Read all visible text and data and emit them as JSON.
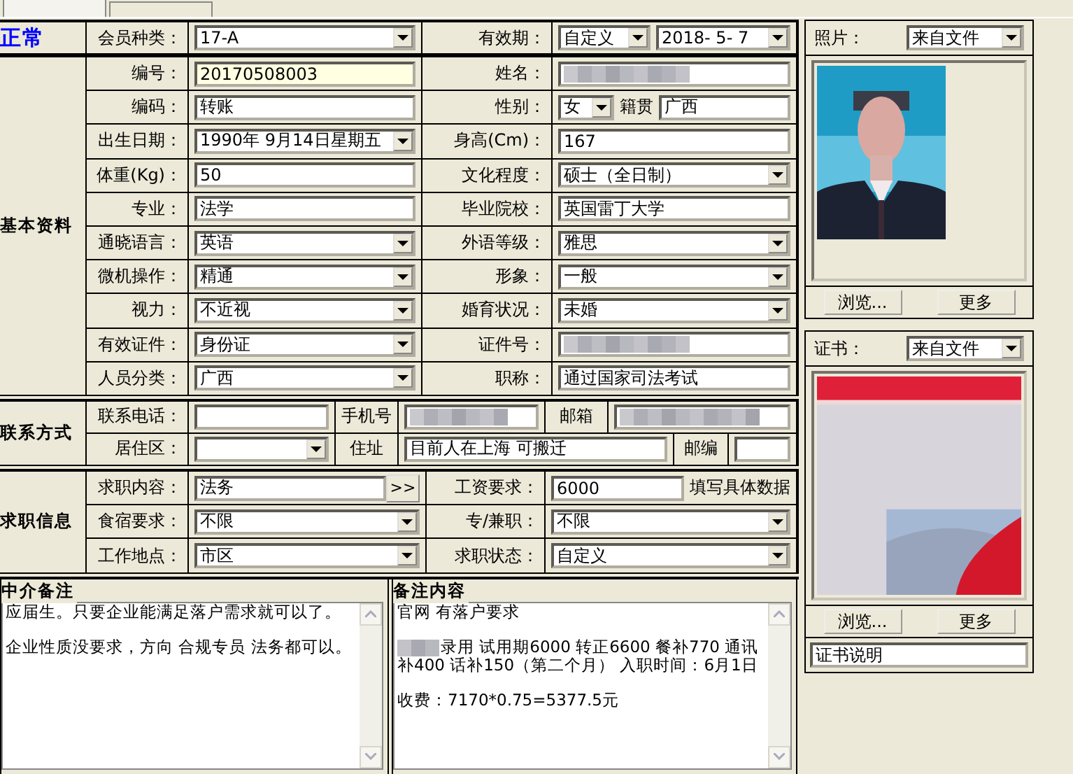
{
  "status": "正常",
  "member_type": {
    "label": "会员种类：",
    "kind": "select",
    "value": "17-A"
  },
  "validity": {
    "label": "有效期：",
    "mode": "自定义",
    "date": "2018- 5- 7"
  },
  "basic": {
    "title": "基本资料",
    "rows": [
      {
        "left": {
          "label": "编号：",
          "kind": "highlighted",
          "value": "20170508003"
        },
        "right": {
          "label": "姓名：",
          "kind": "redacted"
        }
      },
      {
        "left": {
          "label": "编码：",
          "kind": "text",
          "value": "转账"
        },
        "right": {
          "label": "性别：",
          "kind": "gender",
          "value": "女",
          "extra_label": "籍贯",
          "extra_value": "广西"
        }
      },
      {
        "left": {
          "label": "出生日期：",
          "kind": "select",
          "value": "1990年 9月14日星期五"
        },
        "right": {
          "label": "身高(Cm)：",
          "kind": "text",
          "value": "167"
        }
      },
      {
        "left": {
          "label": "体重(Kg)：",
          "kind": "text",
          "value": "50"
        },
        "right": {
          "label": "文化程度：",
          "kind": "select",
          "value": "硕士（全日制）"
        }
      },
      {
        "left": {
          "label": "专业：",
          "kind": "text",
          "value": "法学"
        },
        "right": {
          "label": "毕业院校：",
          "kind": "text",
          "value": "英国雷丁大学"
        }
      },
      {
        "left": {
          "label": "通晓语言：",
          "kind": "select",
          "value": "英语"
        },
        "right": {
          "label": "外语等级：",
          "kind": "select",
          "value": "雅思"
        }
      },
      {
        "left": {
          "label": "微机操作：",
          "kind": "select",
          "value": "精通"
        },
        "right": {
          "label": "形象：",
          "kind": "select",
          "value": "一般"
        }
      },
      {
        "left": {
          "label": "视力：",
          "kind": "select",
          "value": "不近视"
        },
        "right": {
          "label": "婚育状况：",
          "kind": "select",
          "value": "未婚"
        }
      },
      {
        "left": {
          "label": "有效证件：",
          "kind": "select",
          "value": "身份证"
        },
        "right": {
          "label": "证件号：",
          "kind": "redacted"
        }
      },
      {
        "left": {
          "label": "人员分类：",
          "kind": "select",
          "value": "广西"
        },
        "right": {
          "label": "职称：",
          "kind": "text",
          "value": "通过国家司法考试"
        }
      }
    ]
  },
  "contact": {
    "title": "联系方式",
    "phone_label": "联系电话：",
    "mobile_label": "手机号",
    "email_label": "邮箱",
    "district_label": "居住区：",
    "address_label": "住址",
    "address": "目前人在上海 可搬迁",
    "postcode_label": "邮编"
  },
  "job": {
    "title": "求职信息",
    "rows": [
      {
        "left": {
          "label": "求职内容：",
          "kind": "picker",
          "value": "法务",
          "button": ">>"
        },
        "right": {
          "label": "工资要求：",
          "kind": "text_hint",
          "value": "6000",
          "hint": "填写具体数据"
        }
      },
      {
        "left": {
          "label": "食宿要求：",
          "kind": "select",
          "value": "不限"
        },
        "right": {
          "label": "专/兼职：",
          "kind": "select",
          "value": "不限"
        }
      },
      {
        "left": {
          "label": "工作地点：",
          "kind": "select",
          "value": "市区"
        },
        "right": {
          "label": "求职状态：",
          "kind": "select",
          "value": "自定义"
        }
      }
    ]
  },
  "agent_notes": {
    "title": "中介备注",
    "paragraphs": [
      {
        "text": "应届生。只要企业能满足落户需求就可以了。"
      },
      {
        "text": "企业性质没要求，方向 合规专员 法务都可以。"
      }
    ]
  },
  "remarks": {
    "title": "备注内容",
    "paragraphs": [
      {
        "text": "官网 有落户要求"
      },
      {
        "text": "录用 试用期6000 转正6600 餐补770 通讯补400 话补150（第二个月） 入职时间：6月1日",
        "redacted_prefix": true
      },
      {
        "text": "收费：7170*0.75=5377.5元"
      }
    ]
  },
  "photo": {
    "label": "照片：",
    "source": "来自文件",
    "buttons": [
      "浏览...",
      "更多"
    ]
  },
  "certificate": {
    "label": "证书：",
    "source": "来自文件",
    "buttons": [
      "浏览...",
      "更多"
    ],
    "caption": "证书说明"
  }
}
